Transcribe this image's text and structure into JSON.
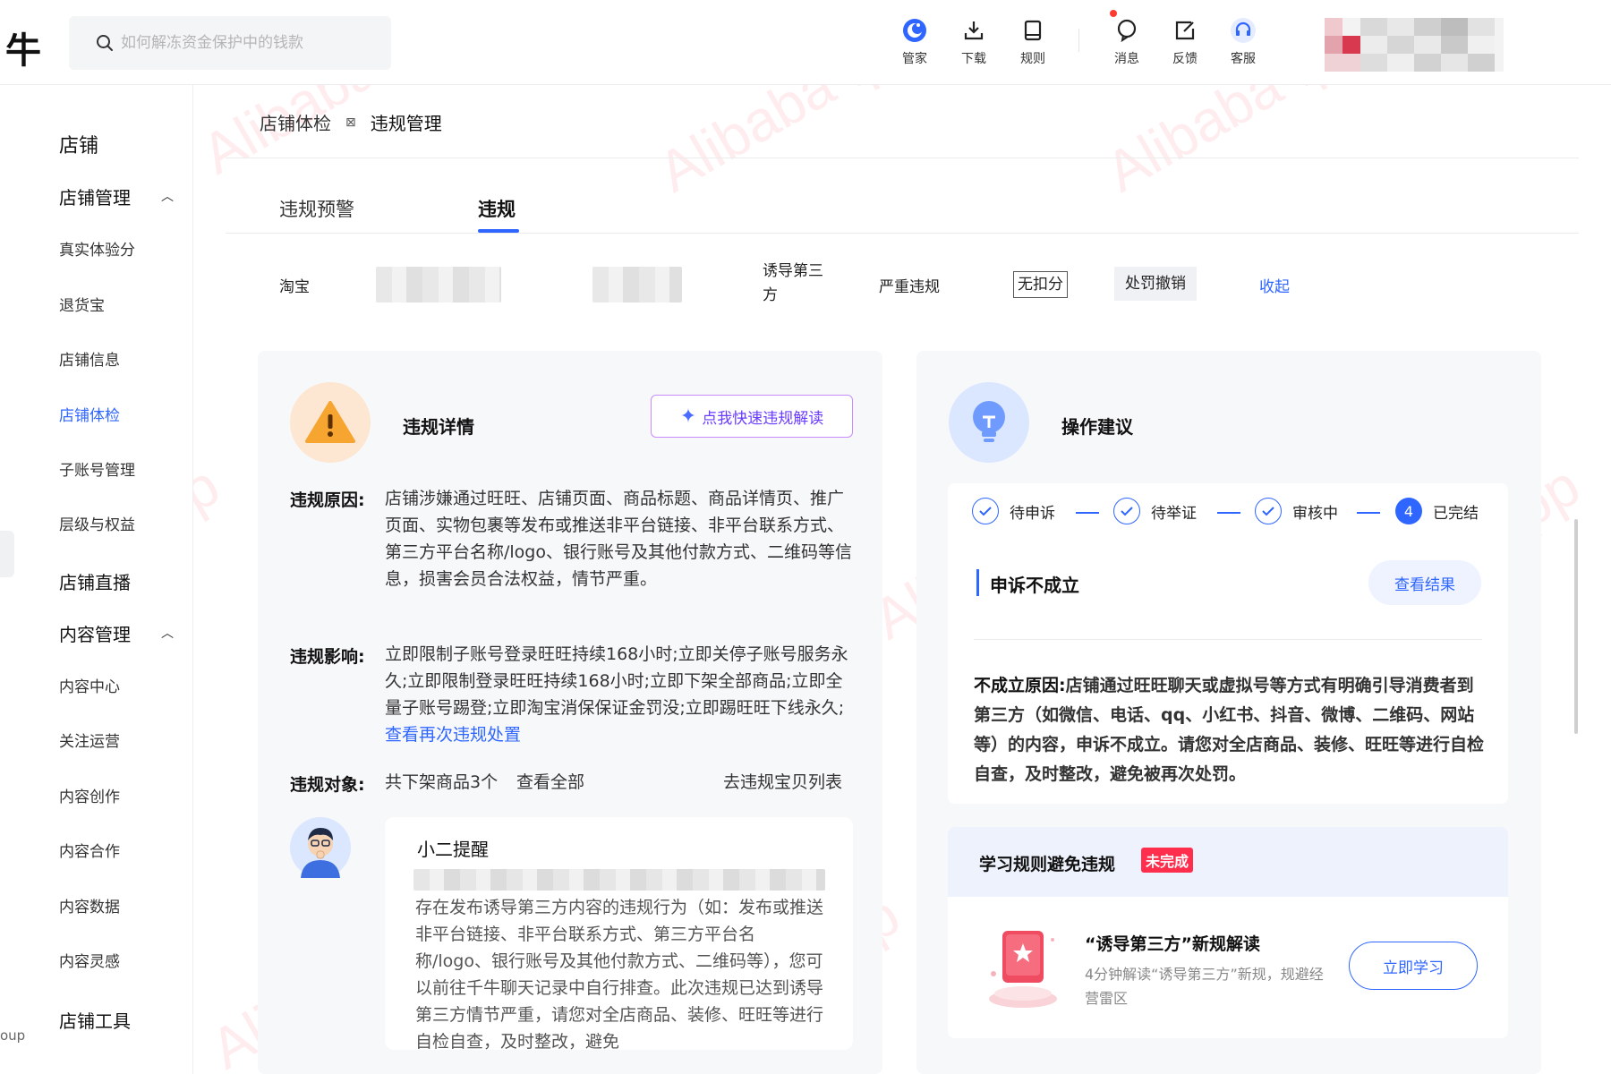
{
  "app": {
    "logo_char": "牛"
  },
  "search": {
    "placeholder": "如何解冻资金保护中的钱款"
  },
  "toolbar": {
    "items": [
      {
        "label": "管家",
        "icon": "butler-icon"
      },
      {
        "label": "下载",
        "icon": "download-icon"
      },
      {
        "label": "规则",
        "icon": "rules-book-icon"
      },
      {
        "label": "消息",
        "icon": "message-icon"
      },
      {
        "label": "反馈",
        "icon": "feedback-icon"
      },
      {
        "label": "客服",
        "icon": "customer-service-icon"
      }
    ]
  },
  "sidebar": {
    "section_title": "店铺",
    "groups": [
      {
        "label": "店铺管理",
        "items": [
          "真实体验分",
          "退货宝",
          "店铺信息",
          "店铺体检",
          "子账号管理",
          "层级与权益"
        ]
      },
      {
        "label": "店铺直播",
        "items": []
      },
      {
        "label": "内容管理",
        "items": [
          "内容中心",
          "关注运营",
          "内容创作",
          "内容合作",
          "内容数据",
          "内容灵感"
        ]
      },
      {
        "label": "店铺工具",
        "items": []
      }
    ],
    "active_item": "店铺体检",
    "cut_text": "oup"
  },
  "breadcrumb": {
    "parent": "店铺体检",
    "separator": "⊠",
    "current": "违规管理"
  },
  "tabs": [
    {
      "label": "违规预警",
      "active": false
    },
    {
      "label": "违规",
      "active": true
    }
  ],
  "violation_row": {
    "platform": "淘宝",
    "type": "诱导第三方",
    "severity": "严重违规",
    "deduction": "无扣分",
    "status": "处罚撤销",
    "collapse": "收起"
  },
  "detail": {
    "title": "违规详情",
    "ai_button": "点我快速违规解读",
    "reason_label": "违规原因:",
    "reason_text": "店铺涉嫌通过旺旺、店铺页面、商品标题、商品详情页、推广页面、实物包裹等发布或推送非平台链接、非平台联系方式、第三方平台名称/logo、银行账号及其他付款方式、二维码等信息，损害会员合法权益，情节严重。",
    "impact_label": "违规影响:",
    "impact_text": "立即限制子账号登录旺旺持续168小时;立即关停子账号服务永久;立即限制登录旺旺持续168小时;立即下架全部商品;立即全量子账号踢登;立即淘宝消保保证金罚没;立即踢旺旺下线永久;",
    "impact_link": "查看再次违规处置",
    "object_label": "违规对象:",
    "object_text": "共下架商品3个",
    "object_link_all": "查看全部",
    "object_link_list": "去违规宝贝列表",
    "reminder_title": "小二提醒",
    "reminder_text": "存在发布诱导第三方内容的违规行为（如：发布或推送非平台链接、非平台联系方式、第三方平台名称/logo、银行账号及其他付款方式、二维码等），您可以前往千牛聊天记录中自行排查。此次违规已达到诱导第三方情节严重，请您对全店商品、装修、旺旺等进行自检自查，及时整改，避免"
  },
  "advice": {
    "title": "操作建议",
    "steps": [
      {
        "label": "待申诉",
        "done": true
      },
      {
        "label": "待举证",
        "done": true
      },
      {
        "label": "审核中",
        "done": true
      },
      {
        "label": "已完结",
        "done": false,
        "number": "4"
      }
    ],
    "result_title": "申诉不成立",
    "result_button": "查看结果",
    "reason_label": "不成立原因:",
    "reason_text": "店铺通过旺旺聊天或虚拟号等方式有明确引导消费者到第三方（如微信、电话、qq、小红书、抖音、微博、二维码、网站等）的内容，申诉不成立。请您对全店商品、装修、旺旺等进行自检自查，及时整改，避免被再次处罚。"
  },
  "learn": {
    "title": "学习规则避免违规",
    "badge": "未完成",
    "course_title": "“诱导第三方”新规解读",
    "course_desc": "4分钟解读“诱导第三方”新规，规避经营雷区",
    "button": "立即学习"
  },
  "watermark": {
    "text": "Alibaba-ipp"
  },
  "colors": {
    "accent": "#2f66ff",
    "warning": "#f7a531",
    "badge_red": "#ff2e4d",
    "panel_bg": "#f7f8fa"
  }
}
